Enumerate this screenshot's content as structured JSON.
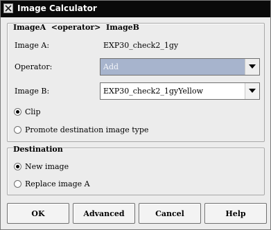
{
  "window": {
    "title": "Image Calculator"
  },
  "expression_group": {
    "title": "ImageA  <operator>  ImageB",
    "image_a_label": "Image A:",
    "image_a_value": "EXP30_check2_1gy",
    "operator_label": "Operator:",
    "operator_value": "Add",
    "image_b_label": "Image B:",
    "image_b_value": "EXP30_check2_1gyYellow",
    "clip_label": "Clip",
    "clip_selected": true,
    "promote_label": "Promote destination image type",
    "promote_selected": false
  },
  "destination_group": {
    "title": "Destination",
    "new_image_label": "New image",
    "new_image_selected": true,
    "replace_label": "Replace image A",
    "replace_selected": false
  },
  "buttons": {
    "ok": "OK",
    "advanced": "Advanced",
    "cancel": "Cancel",
    "help": "Help"
  }
}
